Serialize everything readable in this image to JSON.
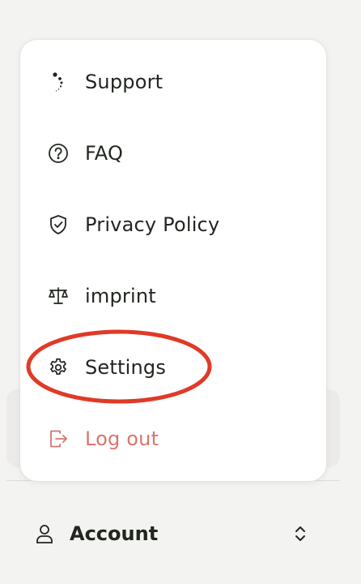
{
  "menu": {
    "items": [
      {
        "label": "Support",
        "icon": "support-icon"
      },
      {
        "label": "FAQ",
        "icon": "question-circle-icon"
      },
      {
        "label": "Privacy Policy",
        "icon": "shield-check-icon"
      },
      {
        "label": "imprint",
        "icon": "scales-icon"
      },
      {
        "label": "Settings",
        "icon": "gear-icon"
      },
      {
        "label": "Log out",
        "icon": "logout-icon"
      }
    ]
  },
  "account": {
    "label": "Account",
    "icon": "user-icon",
    "toggle_icon": "chevron-up-down-icon"
  },
  "colors": {
    "text": "#21261f",
    "danger": "#d9756c",
    "annotation": "#e03a27",
    "menu_bg": "#ffffff",
    "page_bg": "#f3f3f1"
  }
}
